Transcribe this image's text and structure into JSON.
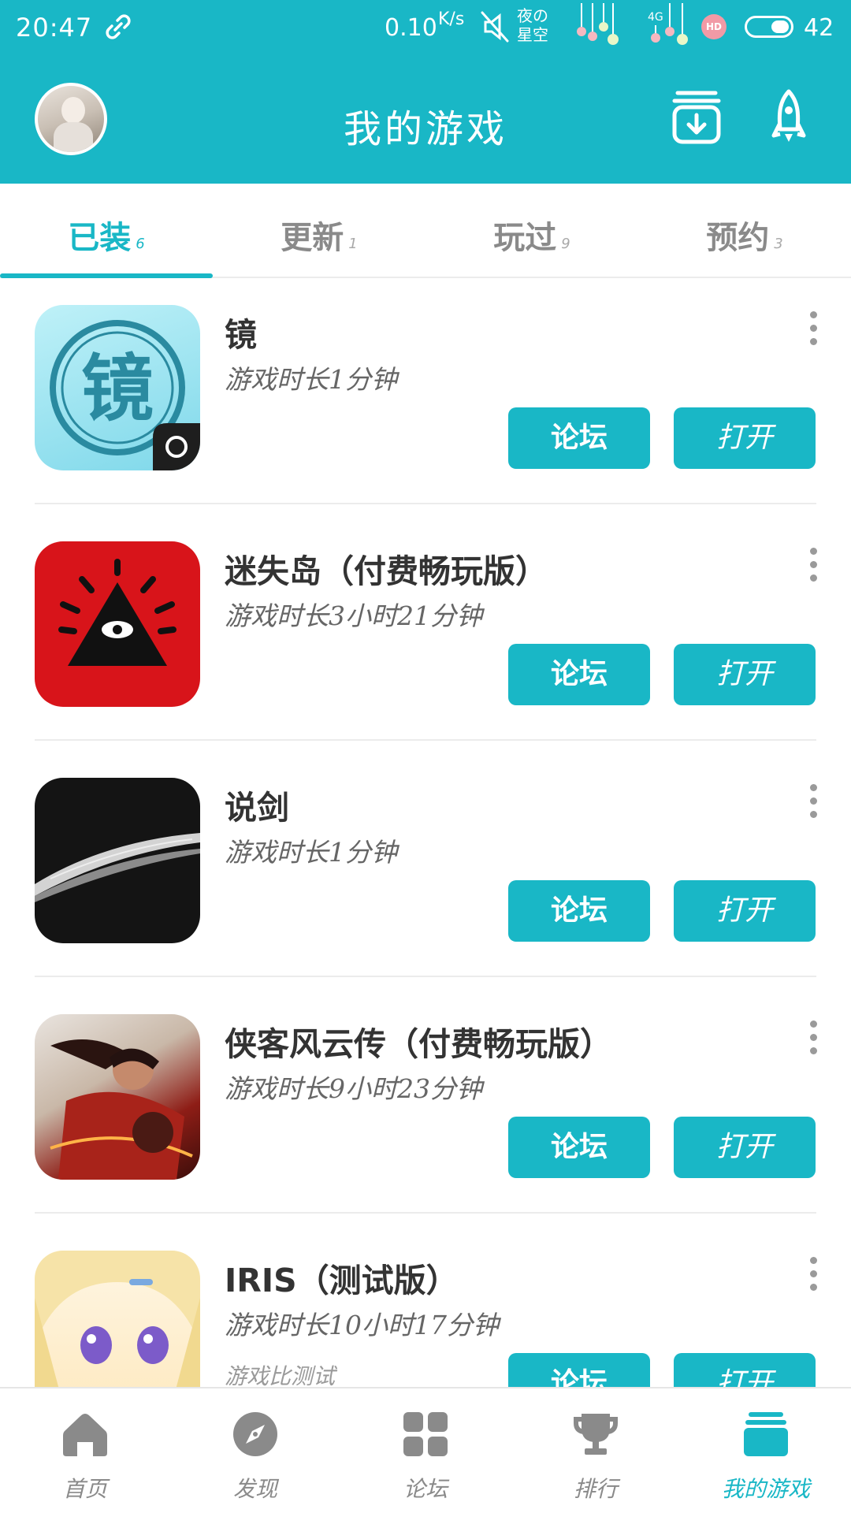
{
  "status_bar": {
    "time": "20:47",
    "speed": "0.10",
    "speed_unit": "K/s",
    "carrier_line1": "夜の",
    "carrier_line2": "星空",
    "network": "4G",
    "hd": "HD",
    "battery": "42"
  },
  "header": {
    "title": "我的游戏"
  },
  "tabs": [
    {
      "label": "已装",
      "count": "6",
      "active": true
    },
    {
      "label": "更新",
      "count": "1",
      "active": false
    },
    {
      "label": "玩过",
      "count": "9",
      "active": false
    },
    {
      "label": "预约",
      "count": "3",
      "active": false
    }
  ],
  "games": [
    {
      "name": "镜",
      "playtime": "游戏时长1分钟",
      "forum_label": "论坛",
      "open_label": "打开",
      "icon_text": "镜"
    },
    {
      "name": "迷失岛（付费畅玩版）",
      "playtime": "游戏时长3小时21分钟",
      "forum_label": "论坛",
      "open_label": "打开"
    },
    {
      "name": "说剑",
      "playtime": "游戏时长1分钟",
      "forum_label": "论坛",
      "open_label": "打开"
    },
    {
      "name": "侠客风云传（付费畅玩版）",
      "playtime": "游戏时长9小时23分钟",
      "forum_label": "论坛",
      "open_label": "打开"
    },
    {
      "name": "IRIS（测试版）",
      "playtime": "游戏时长10小时17分钟",
      "extra": "游戏比测试",
      "forum_label": "论坛",
      "open_label": "打开"
    }
  ],
  "bottom_nav": [
    {
      "label": "首页",
      "icon": "home-icon",
      "active": false
    },
    {
      "label": "发现",
      "icon": "compass-icon",
      "active": false
    },
    {
      "label": "论坛",
      "icon": "grid-icon",
      "active": false
    },
    {
      "label": "排行",
      "icon": "trophy-icon",
      "active": false
    },
    {
      "label": "我的游戏",
      "icon": "stack-icon",
      "active": true
    }
  ],
  "colors": {
    "accent": "#19b7c6",
    "inactive": "#8a8a8a"
  }
}
